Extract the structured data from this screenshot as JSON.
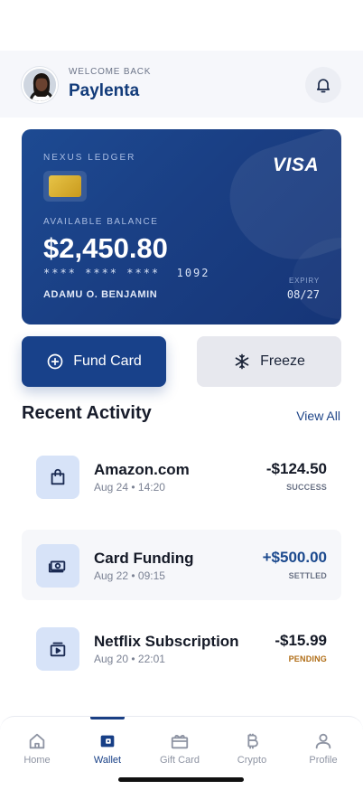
{
  "header": {
    "welcome": "WELCOME BACK",
    "username": "Paylenta"
  },
  "card": {
    "bank_name": "NEXUS LEDGER",
    "network": "VISA",
    "balance_label": "AVAILABLE BALANCE",
    "balance": "$2,450.80",
    "number": "**** **** ****  1092",
    "holder": "ADAMU O. BENJAMIN",
    "expiry_label": "EXPIRY",
    "expiry": "08/27"
  },
  "actions": {
    "fund": "Fund Card",
    "freeze": "Freeze"
  },
  "activity": {
    "title": "Recent Activity",
    "view_all": "View All",
    "items": [
      {
        "name": "Amazon.com",
        "date": "Aug 24 • 14:20",
        "amount": "-$124.50",
        "status": "SUCCESS",
        "icon": "shopping-bag-icon"
      },
      {
        "name": "Card Funding",
        "date": "Aug 22 • 09:15",
        "amount": "+$500.00",
        "status": "SETTLED",
        "icon": "money-icon"
      },
      {
        "name": "Netflix Subscription",
        "date": "Aug 20 • 22:01",
        "amount": "-$15.99",
        "status": "PENDING",
        "icon": "video-icon"
      }
    ]
  },
  "tabs": [
    {
      "label": "Home",
      "icon": "home-icon"
    },
    {
      "label": "Wallet",
      "icon": "wallet-icon"
    },
    {
      "label": "Gift Card",
      "icon": "gift-card-icon"
    },
    {
      "label": "Crypto",
      "icon": "bitcoin-icon"
    },
    {
      "label": "Profile",
      "icon": "profile-icon"
    }
  ],
  "colors": {
    "primary": "#18418a",
    "amount_positive": "#1c4a8e",
    "status_pending": "#b06d16",
    "status_neutral": "#6b7386"
  }
}
